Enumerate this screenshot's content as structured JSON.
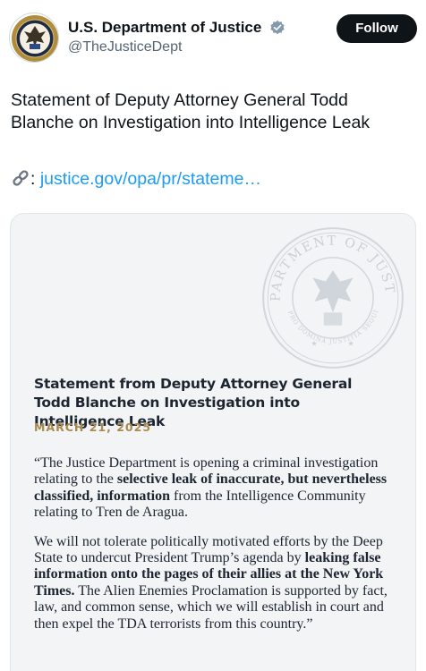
{
  "account": {
    "display_name": "U.S. Department of Justice",
    "handle": "@TheJusticeDept",
    "verified": true,
    "follow_label": "Follow"
  },
  "tweet": {
    "text": "Statement of Deputy Attorney General Todd Blanche on Investigation into Intelligence Leak",
    "link_emoji": "link-icon",
    "link_separator": ":",
    "link_text": "justice.gov/opa/pr/stateme…"
  },
  "card": {
    "seal_text": "DEPARTMENT OF JUSTICE",
    "seal_motto": "QUI PRO DOMINA JUSTITIA SEQUITUR",
    "title": "Statement from Deputy Attorney General Todd Blanche on Investigation into Intelligence Leak",
    "date": "MARCH 21, 2025",
    "para1": {
      "part1": "“The Justice Department is opening a criminal investigation relating to the ",
      "bold1": "selective leak of inaccurate, but nevertheless classified, information",
      "part2": " from the Intelligence Community relating to Tren de Aragua."
    },
    "para2": {
      "part1": "We will not tolerate politically motivated efforts by the Deep State to undercut President Trump’s agenda by ",
      "bold1": "leaking false information onto the pages of their allies at the New York Times.",
      "part2": " The Alien Enemies Proclamation is supported by fact, law, and common sense, which we will establish in court and then expel the TDA terrorists from this country.”"
    }
  },
  "colors": {
    "link": "#1d9bf0",
    "verified_badge": "#829aab",
    "follow_bg": "#0f1419",
    "card_bg": "#f2f4f6",
    "date_gold": "#a88a4e"
  }
}
